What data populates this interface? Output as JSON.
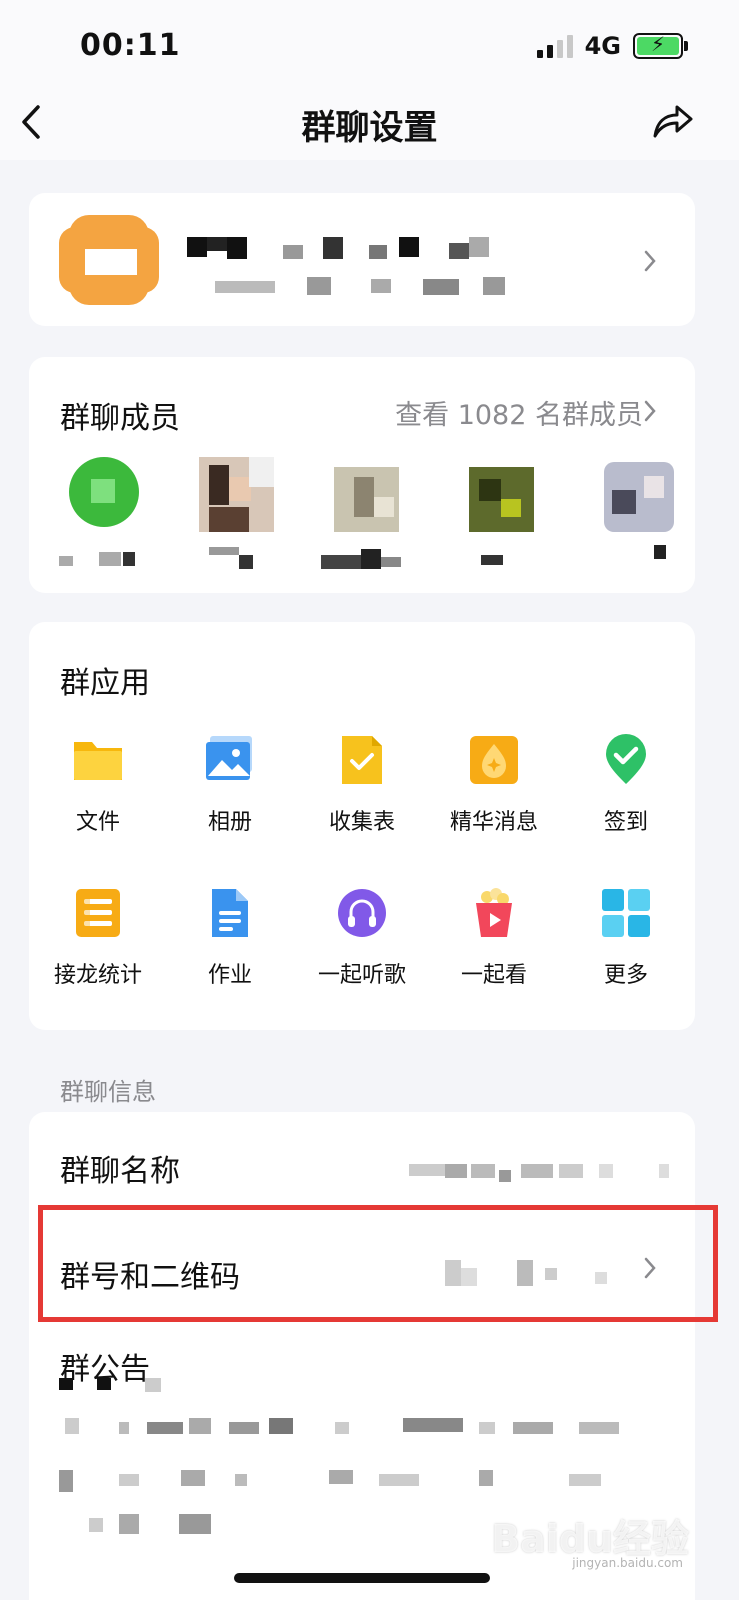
{
  "status_bar": {
    "time": "00:11",
    "network": "4G"
  },
  "nav": {
    "title": "群聊设置"
  },
  "members": {
    "title": "群聊成员",
    "view_all": "查看 1082 名群成员"
  },
  "group_apps": {
    "title": "群应用",
    "items": [
      {
        "label": "文件",
        "icon": "folder-icon"
      },
      {
        "label": "相册",
        "icon": "photo-album-icon"
      },
      {
        "label": "收集表",
        "icon": "collection-form-icon"
      },
      {
        "label": "精华消息",
        "icon": "essence-message-icon"
      },
      {
        "label": "签到",
        "icon": "check-in-icon"
      },
      {
        "label": "接龙统计",
        "icon": "chain-stats-icon"
      },
      {
        "label": "作业",
        "icon": "homework-icon"
      },
      {
        "label": "一起听歌",
        "icon": "listen-together-icon"
      },
      {
        "label": "一起看",
        "icon": "watch-together-icon"
      },
      {
        "label": "更多",
        "icon": "more-apps-icon"
      }
    ]
  },
  "group_info": {
    "header": "群聊信息",
    "name_label": "群聊名称",
    "id_qr_label": "群号和二维码",
    "announcement_label": "群公告"
  },
  "colors": {
    "highlight": "#e53935",
    "background": "#f4f5f9"
  },
  "watermark": {
    "text": "Baidu经验",
    "sub": "jingyan.baidu.com"
  }
}
